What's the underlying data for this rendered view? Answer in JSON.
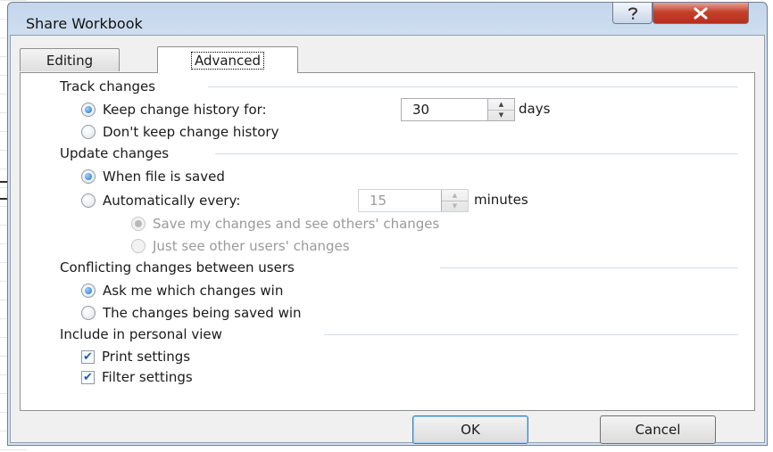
{
  "dialog": {
    "title": "Share Workbook",
    "help_icon": "question-mark-icon",
    "close_icon": "close-x-icon"
  },
  "tabs": [
    {
      "label": "Editing",
      "selected": false
    },
    {
      "label": "Advanced",
      "selected": true
    }
  ],
  "track_changes": {
    "title": "Track changes",
    "keep_history": {
      "label": "Keep change history for:",
      "mnemonic": "K",
      "selected": true
    },
    "days_value": "30",
    "days_unit": "days",
    "dont_keep": {
      "label": "Don't keep change history",
      "mnemonic": "D",
      "selected": false
    }
  },
  "update_changes": {
    "title": "Update changes",
    "when_saved": {
      "label": "When file is saved",
      "mnemonic": "W",
      "selected": true
    },
    "auto_every": {
      "label": "Automatically every:",
      "mnemonic": "A",
      "selected": false
    },
    "minutes_value": "15",
    "minutes_unit": "minutes",
    "save_and_see": {
      "label": "Save my changes and see others' changes",
      "selected": true,
      "disabled": true
    },
    "just_see": {
      "label": "Just see other users' changes",
      "selected": false,
      "disabled": true
    }
  },
  "conflicts": {
    "title": "Conflicting changes between users",
    "ask_me": {
      "label": "Ask me which changes win",
      "selected": true
    },
    "saved_win": {
      "label": "The changes being saved win",
      "selected": false
    }
  },
  "personal_view": {
    "title": "Include in personal view",
    "print_settings": {
      "label": "Print settings",
      "checked": true
    },
    "filter_settings": {
      "label": "Filter settings",
      "checked": true
    }
  },
  "buttons": {
    "ok": "OK",
    "cancel": "Cancel"
  },
  "colors": {
    "title_bar": "#c4d6ec",
    "close_button": "#c4422b",
    "accent_radio": "#1b6fc9"
  }
}
